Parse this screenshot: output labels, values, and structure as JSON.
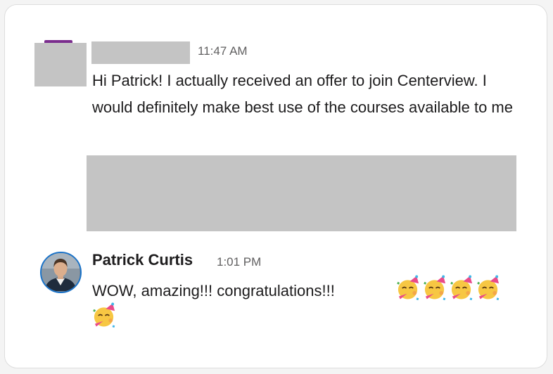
{
  "messages": [
    {
      "author": "",
      "time": "11:47 AM",
      "text": "Hi Patrick! I actually received an offer to join Centerview. I would definitely make best use of the courses available to me"
    },
    {
      "author": "Patrick Curtis",
      "time": "1:01 PM",
      "text": "WOW, amazing!!!  congratulations!!!",
      "emoji": "partying-face",
      "emoji_count": 5
    }
  ],
  "colors": {
    "text": "#1d1c1d",
    "timestamp": "#616061",
    "redaction": "#c4c4c4",
    "avatar_ring": "#1a73c9"
  }
}
